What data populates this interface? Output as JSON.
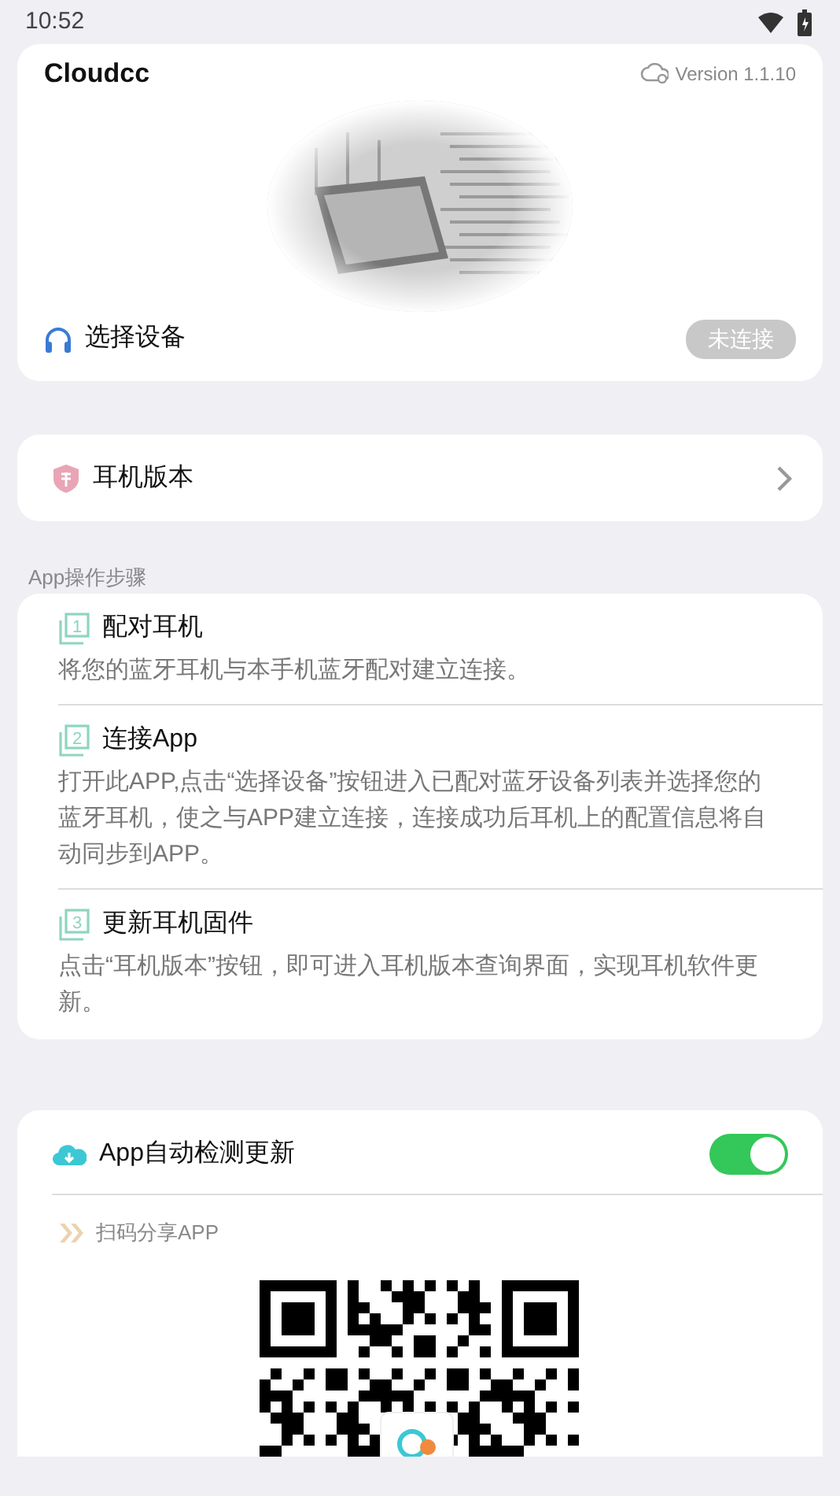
{
  "status_bar": {
    "time": "10:52"
  },
  "device_card": {
    "app_name": "Cloudcc",
    "version": "Version 1.1.10",
    "select_label": "选择设备",
    "connection_status": "未连接",
    "connected": false
  },
  "firmware_row": {
    "label": "耳机版本"
  },
  "steps_section": {
    "heading": "App操作步骤",
    "steps": [
      {
        "number": "1",
        "title": "配对耳机",
        "description": "将您的蓝牙耳机与本手机蓝牙配对建立连接。"
      },
      {
        "number": "2",
        "title": "连接App",
        "description": "打开此APP,点击“选择设备”按钮进入已配对蓝牙设备列表并选择您的蓝牙耳机，使之与APP建立连接，连接成功后耳机上的配置信息将自动同步到APP。"
      },
      {
        "number": "3",
        "title": "更新耳机固件",
        "description": "点击“耳机版本”按钮，即可进入耳机版本查询界面，实现耳机软件更新。"
      }
    ]
  },
  "update_card": {
    "auto_update": {
      "label": "App自动检测更新",
      "on": true
    },
    "share_label": "扫码分享APP"
  }
}
